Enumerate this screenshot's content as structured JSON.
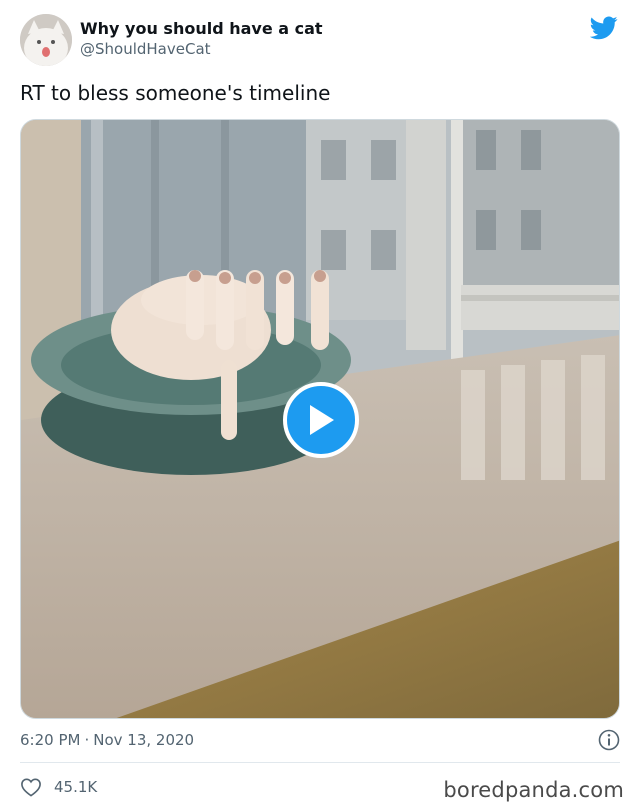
{
  "author": {
    "display_name": "Why you should have a cat",
    "handle": "@ShouldHaveCat",
    "avatar_icon": "white-cat-avatar"
  },
  "brand": {
    "icon": "twitter-bird-icon",
    "color": "#1d9bf0"
  },
  "tweet": {
    "text": "RT to bless someone's timeline",
    "media_type": "video",
    "time": "6:20 PM",
    "separator": "·",
    "date": "Nov 13, 2020"
  },
  "actions": {
    "like_icon": "heart-icon",
    "like_count": "45.1K",
    "info_icon": "info-icon"
  },
  "watermark": "boredpanda.com"
}
